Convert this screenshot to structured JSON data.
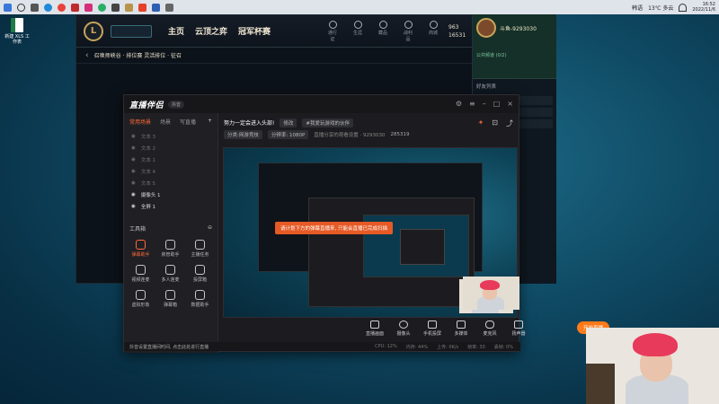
{
  "taskbar": {
    "weather": "13℃ 多云",
    "time": "16:52",
    "date": "2022/11/6",
    "input_mode": "韩语"
  },
  "desktop": {
    "icon_label": "新建 XLS 工作表"
  },
  "lol_client": {
    "nav": [
      "主页",
      "云顶之弈",
      "冠军杯赛"
    ],
    "top_icons": [
      "通行证",
      "生涯",
      "藏品",
      "战利品",
      "商城"
    ],
    "currency_be": "963",
    "currency_rp": "16531",
    "profile_name": "斗鱼-9293030",
    "profile_status": "公共频道 (0/2)",
    "mode_title": "召唤师峡谷 · 排位赛 灵活排位 · 征召",
    "friends_header": "好友列表"
  },
  "stream_app": {
    "brand": "直播伴侣",
    "brand_badge": "抖音",
    "tabs": [
      "常用场景",
      "场景",
      "写直播"
    ],
    "scenes": [
      "文本 3",
      "文本 2",
      "文本 1",
      "文本 4",
      "文本 5",
      "摄像头 1",
      "全屏 1"
    ],
    "tools_title": "工具箱",
    "tools": [
      "弹幕助手",
      "房管助手",
      "主播任务",
      "视频连麦",
      "多人连麦",
      "投屏箱",
      "虚拟形象",
      "弹幕箱",
      "数据助手"
    ],
    "title_line": "努力一定会进入头部!",
    "title_edit": "修改",
    "title_tag": "#我爱玩游戏的伙伴",
    "info_chips": [
      "分类:网游竞技",
      "分辨率: 1080P"
    ],
    "info_text": "直播分享的观看设置 · 9293030",
    "fans": "285319",
    "toast": "请计划下方的弹幕直播来, 只能会直播已完成扫描",
    "bottom_buttons": [
      "直播画面",
      "摄像头",
      "手机投屏",
      "多媒体",
      "麦克风",
      "扬声器"
    ],
    "start_button": "开始直播",
    "status_text": "抖音设置直播间时间, 点击此处进行直播",
    "stats": [
      "CPU: 12%",
      "内存: 44%",
      "上传: 0K/s",
      "帧率: 30",
      "丢帧: 0%"
    ]
  }
}
